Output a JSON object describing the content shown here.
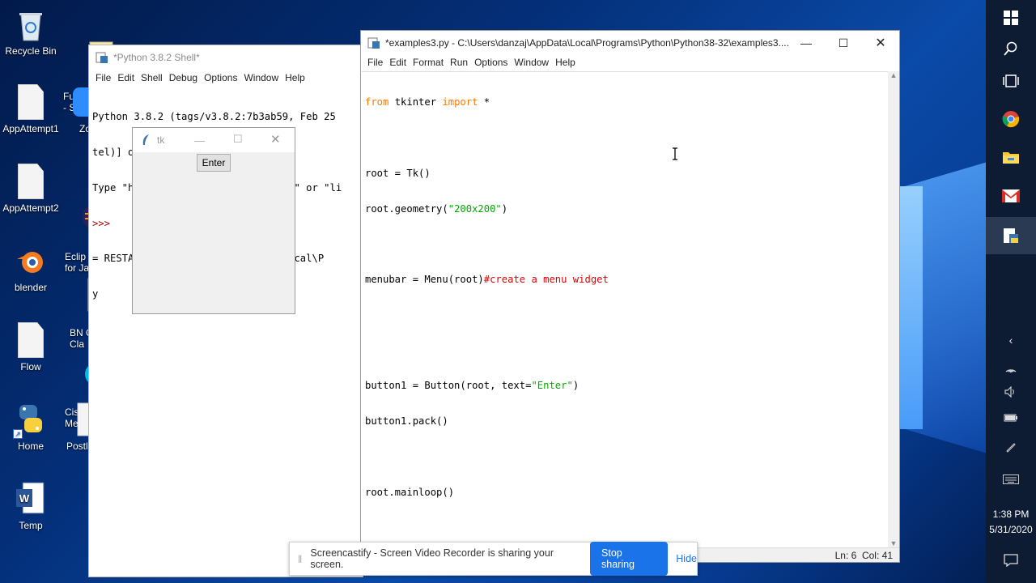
{
  "desktop": {
    "icons": [
      {
        "label": "Recycle Bin",
        "icon": "recycle-bin-icon"
      },
      {
        "label": "Futsal\n- Sh",
        "icon": "document-shortcut-icon"
      },
      {
        "label": "AppAttempt1",
        "icon": "document-icon"
      },
      {
        "label": "Zo",
        "icon": "zoom-icon"
      },
      {
        "label": "AppAttempt2",
        "icon": "document-icon"
      },
      {
        "label": "Eclip\nfor Ja",
        "icon": "eclipse-icon"
      },
      {
        "label": "blender",
        "icon": "blender-icon"
      },
      {
        "label": "BN C\nCla",
        "icon": "document-shortcut-icon"
      },
      {
        "label": "Flow",
        "icon": "document-icon"
      },
      {
        "label": "Cisco\nMee",
        "icon": "webex-icon"
      },
      {
        "label": "Home",
        "icon": "python-icon"
      },
      {
        "label": "Postl",
        "icon": "document-shortcut-icon"
      },
      {
        "label": "Temp",
        "icon": "word-icon"
      }
    ]
  },
  "shell_window": {
    "title": "*Python 3.8.2 Shell*",
    "menu": [
      "File",
      "Edit",
      "Shell",
      "Debug",
      "Options",
      "Window",
      "Help"
    ],
    "lines": [
      "Python 3.8.2 (tags/v3.8.2:7b3ab59, Feb 25",
      "tel)] on win32",
      "Type \"help\", \"copyright\", \"credits\" or \"li",
      ">>>",
      "= RESTA                     ata\\Local\\P",
      "y"
    ]
  },
  "tk_window": {
    "title": "tk",
    "button_label": "Enter"
  },
  "editor_window": {
    "title": "*examples3.py - C:\\Users\\danzaj\\AppData\\Local\\Programs\\Python\\Python38-32\\examples3....",
    "menu": [
      "File",
      "Edit",
      "Format",
      "Run",
      "Options",
      "Window",
      "Help"
    ],
    "code": {
      "line1_kw1": "from",
      "line1_mid": " tkinter ",
      "line1_kw2": "import",
      "line1_end": " *",
      "line2": "root = Tk()",
      "line3_pre": "root.geometry(",
      "line3_str": "\"200x200\"",
      "line3_post": ")",
      "line4_pre": "menubar = Menu(root)",
      "line4_comment": "#create a menu widget",
      "line5_pre": "button1 = Button(root, text=",
      "line5_str": "\"Enter\"",
      "line5_post": ")",
      "line6": "button1.pack()",
      "line7": "root.mainloop()"
    },
    "status": "Ln: 6  Col: 41"
  },
  "share_banner": {
    "message": "Screencastify - Screen Video Recorder is sharing your screen.",
    "stop_label": "Stop sharing",
    "hide_label": "Hide"
  },
  "taskbar": {
    "time": "1:38 PM",
    "date": "5/31/2020"
  },
  "colors": {
    "keyword": "#ff7700",
    "string": "#00aa00",
    "comment": "#dd0000",
    "accent": "#1a73e8"
  }
}
